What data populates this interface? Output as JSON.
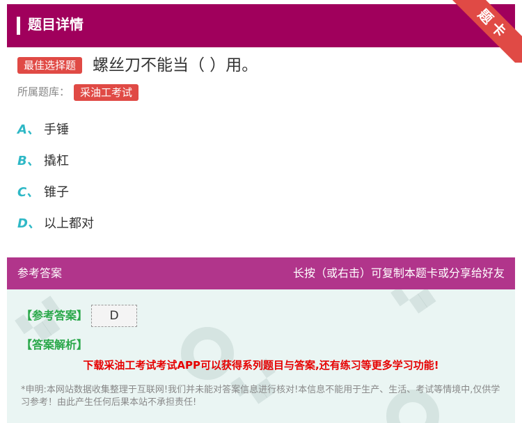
{
  "header": {
    "title": "题目详情",
    "ribbon": "题卡"
  },
  "question": {
    "type_badge": "最佳选择题",
    "text": "螺丝刀不能当（ ）用。",
    "bank_label": "所属题库：",
    "bank_tag": "采油工考试"
  },
  "options": [
    {
      "letter": "A、",
      "text": "手锤"
    },
    {
      "letter": "B、",
      "text": "撬杠"
    },
    {
      "letter": "C、",
      "text": "锥子"
    },
    {
      "letter": "D、",
      "text": "以上都对"
    }
  ],
  "answer": {
    "header_left": "参考答案",
    "header_right": "长按（或右击）可复制本题卡或分享给好友",
    "ref_label": "【参考答案】",
    "ref_value": "D",
    "exp_label": "【答案解析】",
    "promo": "下载采油工考试考试APP可以获得系列题目与答案,还有练习等更多学习功能!",
    "notice": "*申明:本网站数据收集整理于互联网!我们并未能对答案信息进行核对!本信息不能用于生产、生活、考试等情境中,仅供学习参考！由此产生任何后果本站不承担责任!"
  },
  "colors": {
    "header_bg": "#a0005c",
    "answer_header_bg": "#b1358b",
    "badge": "#e04a45",
    "option_letter": "#2fb8c6",
    "label_green": "#2aa84a",
    "promo_red": "#e60000"
  }
}
